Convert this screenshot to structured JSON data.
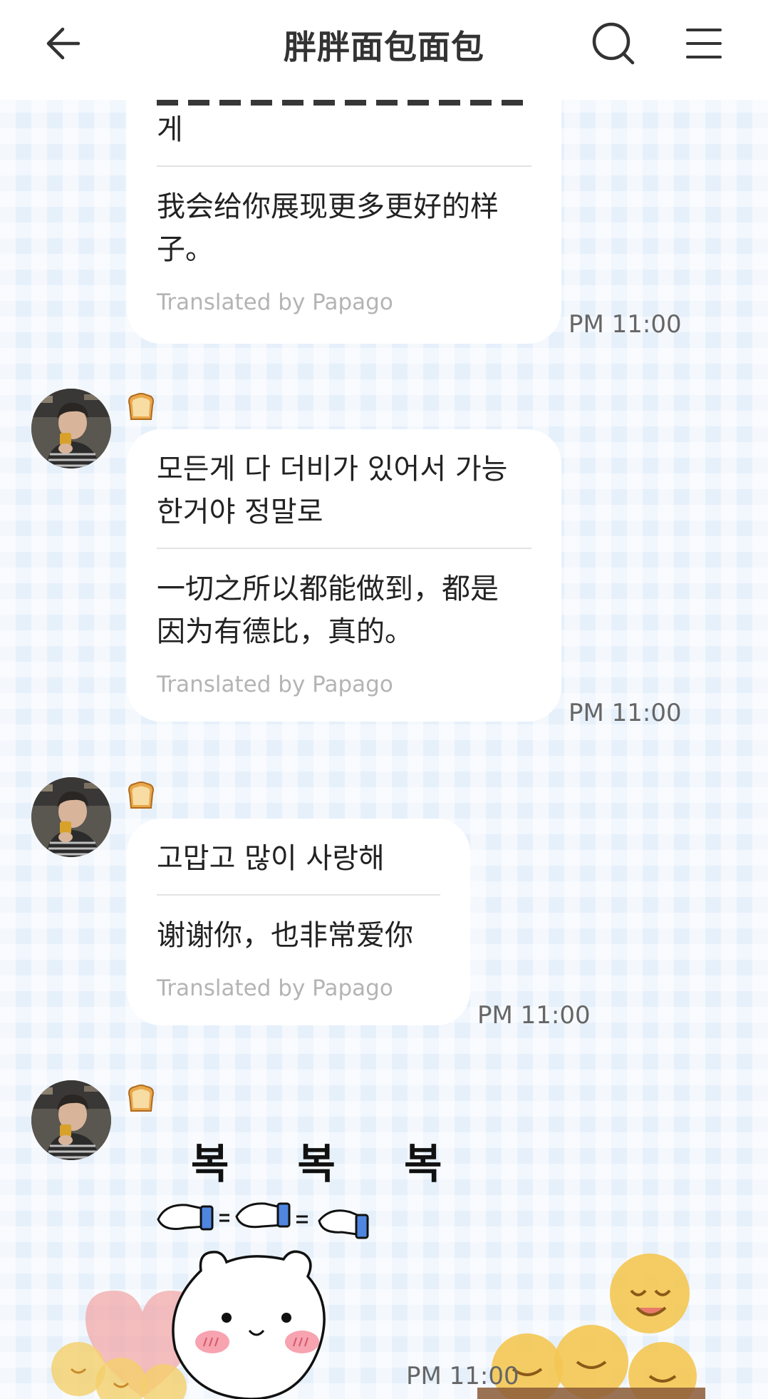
{
  "header": {
    "title": "胖胖面包面包"
  },
  "messages": [
    {
      "original": "게",
      "translation": "我会给你展现更多更好的样子。",
      "credit": "Translated by Papago",
      "time": "PM 11:00"
    },
    {
      "original": "모든게 다 더비가 있어서 가능한거야 정말로",
      "translation": "一切之所以都能做到，都是因为有德比，真的。",
      "credit": "Translated by Papago",
      "time": "PM 11:00"
    },
    {
      "original": "고맙고 많이 사랑해",
      "translation": "谢谢你，也非常爱你",
      "credit": "Translated by Papago",
      "time": "PM 11:00"
    }
  ],
  "sticker": {
    "text": "복 복 복",
    "time": "PM 11:00"
  },
  "colors": {
    "background": "#e6f0fb",
    "bubble": "#ffffff",
    "title": "#333333",
    "credit": "#b4b4b4"
  }
}
